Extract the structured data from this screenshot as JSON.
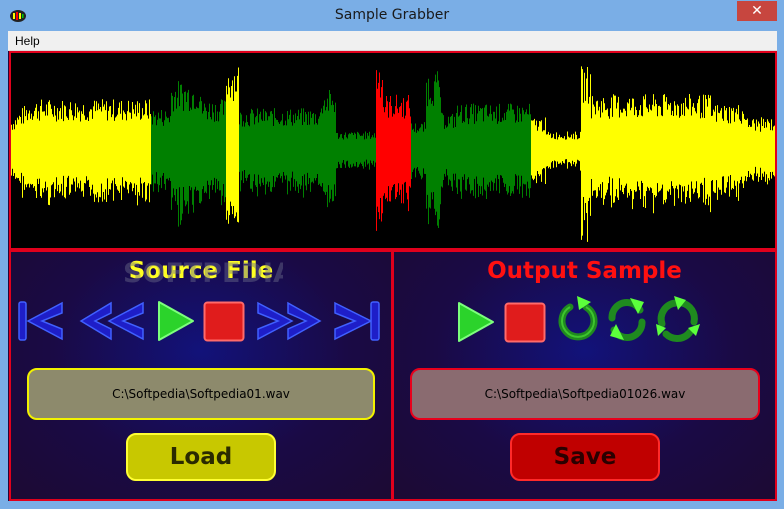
{
  "window": {
    "title": "Sample Grabber",
    "close_glyph": "✕",
    "app_icon": "sample-grabber-logo"
  },
  "menu": {
    "help_label": "Help"
  },
  "waveform": {
    "colors": {
      "background": "#000000",
      "unselected": "#ffff00",
      "segments": "#008000",
      "current": "#ff0000",
      "border": "#e0001c"
    }
  },
  "source_panel": {
    "title": "Source File",
    "file_path": "C:\\Softpedia\\Softpedia01.wav",
    "load_label": "Load",
    "controls": [
      "skip-to-start-icon",
      "rewind-icon",
      "play-icon",
      "stop-icon",
      "fast-forward-icon",
      "skip-to-end-icon"
    ]
  },
  "output_panel": {
    "title": "Output Sample",
    "file_path": "C:\\Softpedia\\Softpedia01026.wav",
    "save_label": "Save",
    "controls": [
      "play-icon",
      "stop-icon",
      "loop-icon",
      "repeat-icon",
      "cycle-icon"
    ]
  },
  "watermark": "SOFTPEDIA"
}
